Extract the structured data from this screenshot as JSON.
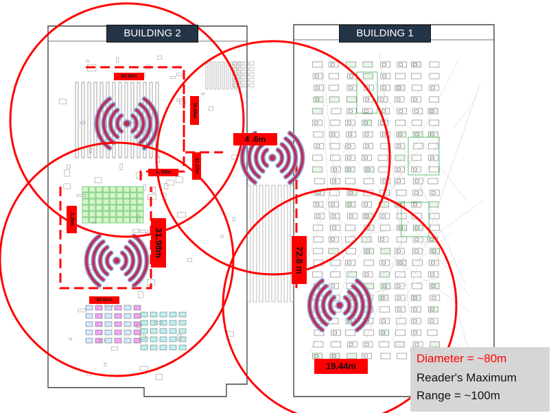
{
  "buildings": {
    "building_2": "BUILDING 2",
    "building_1": "BUILDING 1"
  },
  "dimensions": {
    "d1": "34.06m",
    "d2": "30.86m",
    "d3": "4 .6m",
    "d4": "1. 69m",
    "d5": "11.37m",
    "d6": "3.20m",
    "d7": "31.98m",
    "d8": "72.8 m",
    "d9": "30.81m",
    "d10": "19.44m"
  },
  "legend": {
    "diameter": "Diameter = ~80m",
    "line2": "Reader's Maximum",
    "line3": "Range = ~100m"
  },
  "colors": {
    "coverage_circle": "#ff0000",
    "reader_arcs": "#c42a4a",
    "reader_arc_outline": "#8a9fd6",
    "building_label_bg": "#243447",
    "legend_bg": "#d6d6d6",
    "legend_highlight_text": "#ff0000"
  },
  "icons": {
    "reader": "rfid-reader-icon"
  }
}
